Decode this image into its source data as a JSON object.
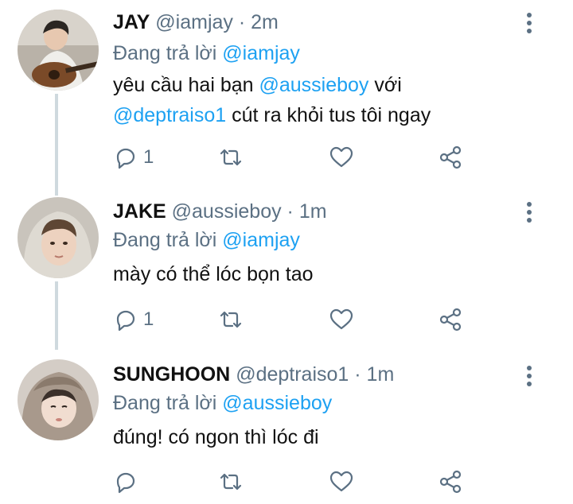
{
  "tweets": [
    {
      "name": "JAY",
      "handle": "@iamjay",
      "time": "· 2m",
      "reply_prefix": "Đang trả lời",
      "reply_to": "@iamjay",
      "body_line1_a": "yêu cầu hai bạn ",
      "body_line1_mention": "@aussieboy",
      "body_line1_b": " với",
      "body_line2_mention": "@deptraiso1",
      "body_line2_b": " cút ra khỏi tus tôi ngay",
      "reply_count": "1"
    },
    {
      "name": "JAKE",
      "handle": "@aussieboy",
      "time": "· 1m",
      "reply_prefix": "Đang trả lời",
      "reply_to": "@iamjay",
      "body": "mày có thể lóc bọn tao",
      "reply_count": "1"
    },
    {
      "name": "SUNGHOON",
      "handle": "@deptraiso1",
      "time": "· 1m",
      "reply_prefix": "Đang trả lời",
      "reply_to": "@aussieboy",
      "body": "đúng! có ngon thì lóc đi",
      "reply_count": ""
    }
  ],
  "icons": {
    "reply": "reply-icon",
    "retweet": "retweet-icon",
    "like": "like-icon",
    "share": "share-icon",
    "more": "more-vertical-icon"
  },
  "colors": {
    "link": "#1da1f2",
    "muted": "#5b7083",
    "thread_line": "#cfd9de"
  }
}
